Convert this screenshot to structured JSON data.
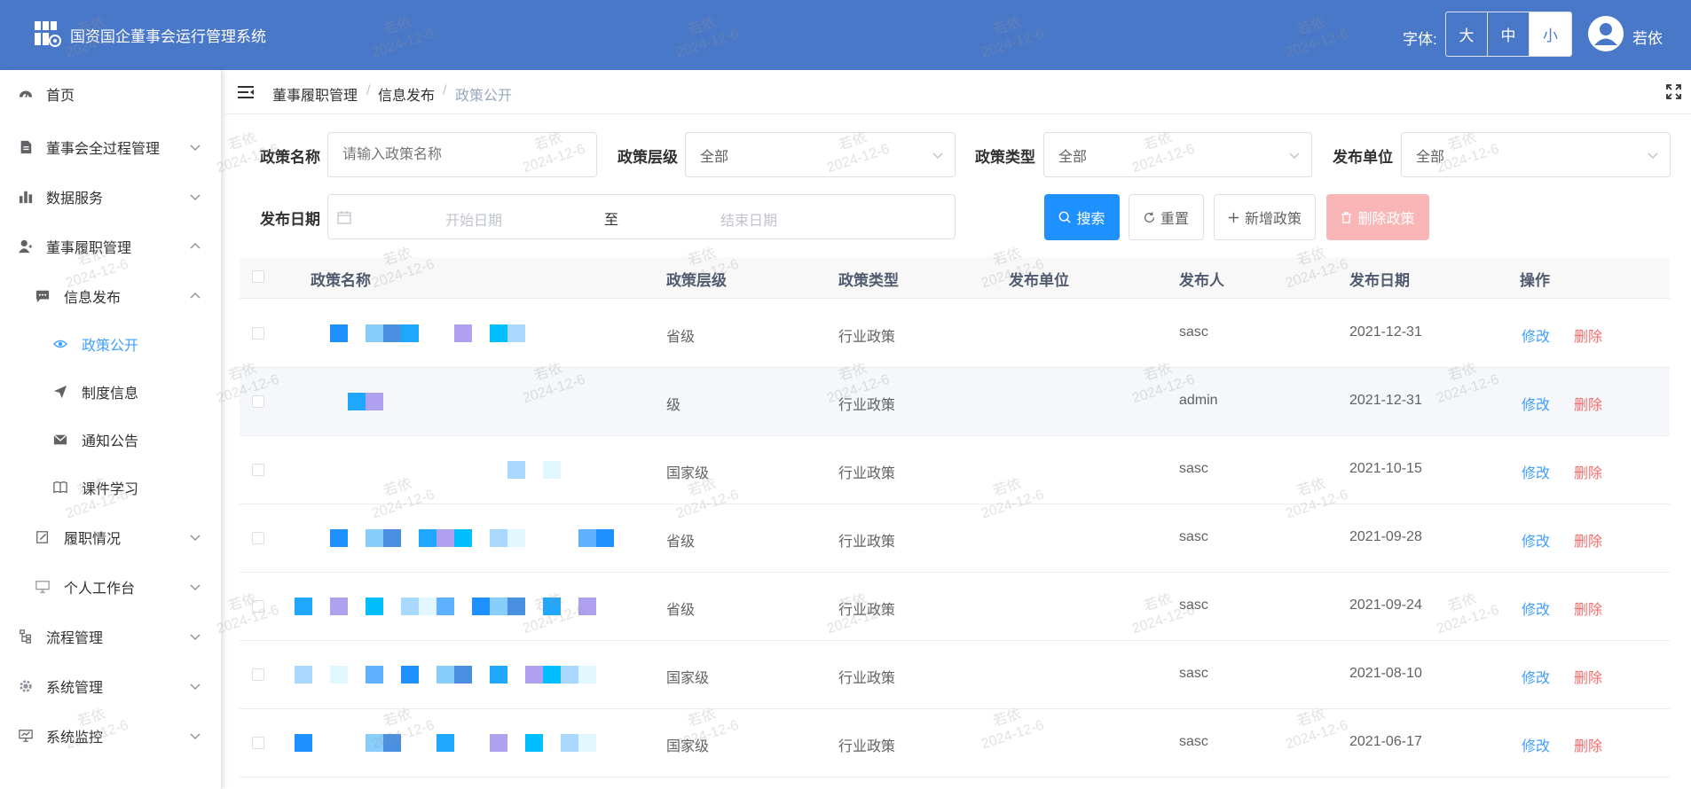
{
  "header": {
    "app_title": "国资国企董事会运行管理系统",
    "font_label": "字体:",
    "font_sizes": [
      "大",
      "中",
      "小"
    ],
    "user_name": "若依"
  },
  "sidebar": {
    "items": [
      {
        "label": "首页",
        "icon": "dashboard-icon"
      },
      {
        "label": "董事会全过程管理",
        "icon": "document-icon"
      },
      {
        "label": "数据服务",
        "icon": "bar-chart-icon"
      },
      {
        "label": "董事履职管理",
        "icon": "user-icon"
      },
      {
        "label": "信息发布",
        "icon": "message-icon"
      },
      {
        "label": "政策公开",
        "icon": "eye-icon"
      },
      {
        "label": "制度信息",
        "icon": "send-icon"
      },
      {
        "label": "通知公告",
        "icon": "mail-icon"
      },
      {
        "label": "课件学习",
        "icon": "book-icon"
      },
      {
        "label": "履职情况",
        "icon": "edit-icon"
      },
      {
        "label": "个人工作台",
        "icon": "monitor-icon"
      },
      {
        "label": "流程管理",
        "icon": "tree-icon"
      },
      {
        "label": "系统管理",
        "icon": "gear-icon"
      },
      {
        "label": "系统监控",
        "icon": "monitor-icon"
      }
    ]
  },
  "breadcrumb": [
    "董事履职管理",
    "信息发布",
    "政策公开"
  ],
  "filters": {
    "policy_name_label": "政策名称",
    "policy_name_placeholder": "请输入政策名称",
    "policy_level_label": "政策层级",
    "policy_level_value": "全部",
    "policy_type_label": "政策类型",
    "policy_type_value": "全部",
    "publisher_unit_label": "发布单位",
    "publisher_unit_value": "全部",
    "date_label": "发布日期",
    "date_start_placeholder": "开始日期",
    "date_sep": "至",
    "date_end_placeholder": "结束日期"
  },
  "buttons": {
    "search": "搜索",
    "reset": "重置",
    "add": "新增政策",
    "delete": "删除政策"
  },
  "table": {
    "columns": [
      "政策名称",
      "政策层级",
      "政策类型",
      "发布单位",
      "发布人",
      "发布日期",
      "操作"
    ],
    "edit_label": "修改",
    "delete_label": "删除",
    "rows": [
      {
        "level": "省级",
        "type": "行业政策",
        "publisher": "sasc",
        "date": "2021-12-31"
      },
      {
        "level": "级",
        "type": "行业政策",
        "publisher": "admin",
        "date": "2021-12-31"
      },
      {
        "level": "国家级",
        "type": "行业政策",
        "publisher": "sasc",
        "date": "2021-10-15"
      },
      {
        "level": "省级",
        "type": "行业政策",
        "publisher": "sasc",
        "date": "2021-09-28"
      },
      {
        "level": "省级",
        "type": "行业政策",
        "publisher": "sasc",
        "date": "2021-09-24"
      },
      {
        "level": "国家级",
        "type": "行业政策",
        "publisher": "sasc",
        "date": "2021-08-10"
      },
      {
        "level": "国家级",
        "type": "行业政策",
        "publisher": "sasc",
        "date": "2021-06-17"
      }
    ]
  },
  "watermark": {
    "name": "若依",
    "date": "2024-12-6"
  },
  "colors": {
    "header": "#4a78c8",
    "primary": "#1e90ff",
    "danger": "#f56c6c",
    "link": "#409eff"
  }
}
